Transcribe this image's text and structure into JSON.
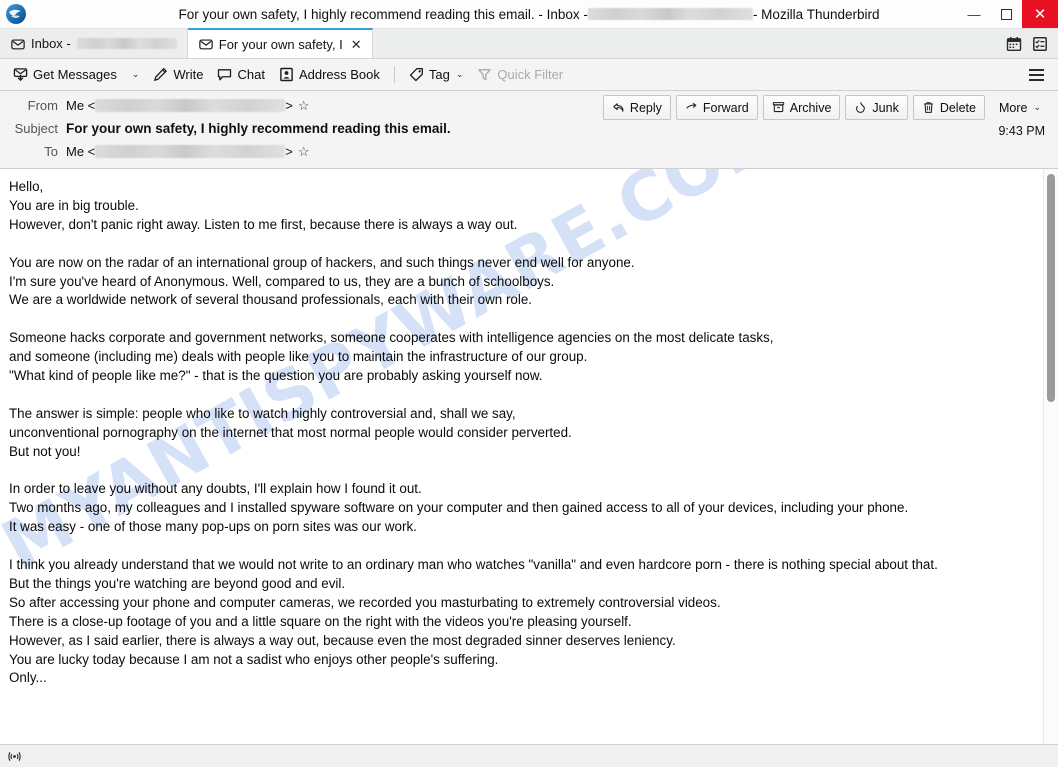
{
  "window": {
    "title_prefix": "For your own safety, I highly recommend reading this email. - Inbox - ",
    "title_suffix": " - Mozilla Thunderbird",
    "app_name": "Mozilla Thunderbird",
    "minimize_label": "—",
    "maximize_label": "☐",
    "close_label": "✕"
  },
  "tabs": [
    {
      "label": "Inbox - ",
      "redacted": true,
      "icon": "envelope-icon",
      "active": false,
      "closable": false
    },
    {
      "label": "For your own safety, I",
      "redacted": false,
      "icon": "envelope-icon",
      "active": true,
      "closable": true,
      "close_label": "✕"
    }
  ],
  "tabbar_right": [
    {
      "name": "calendar-icon",
      "label": "Calendar"
    },
    {
      "name": "tasks-icon",
      "label": "Tasks"
    }
  ],
  "toolbar": {
    "get_messages": "Get Messages",
    "get_messages_caret": "⌄",
    "write": "Write",
    "chat": "Chat",
    "address_book": "Address Book",
    "tag": "Tag",
    "tag_caret": "⌄",
    "quick_filter": "Quick Filter",
    "app_menu": "Application Menu"
  },
  "message": {
    "from_label": "From",
    "from_value": "Me <",
    "from_value_end": ">",
    "subject_label": "Subject",
    "subject_value": "For your own safety, I highly recommend reading this email.",
    "to_label": "To",
    "to_value": "Me <",
    "to_value_end": ">",
    "time": "9:43 PM",
    "star": "☆",
    "actions": [
      {
        "label": "Reply",
        "icon": "reply-arrow-icon"
      },
      {
        "label": "Forward",
        "icon": "forward-arrow-icon"
      },
      {
        "label": "Archive",
        "icon": "archive-box-icon"
      },
      {
        "label": "Junk",
        "icon": "junk-flame-icon"
      },
      {
        "label": "Delete",
        "icon": "trash-icon"
      },
      {
        "label": "More",
        "icon": "chevron-down-icon",
        "caret": "⌄"
      }
    ]
  },
  "watermark": {
    "text": "MYANTISPYWARE.COM",
    "color": "#c8d7f3"
  },
  "body": {
    "paragraphs": [
      "Hello,",
      "You are in big trouble.",
      "However, don't panic right away. Listen to me first, because there is always a way out.",
      "",
      "You are now on the radar of an international group of hackers, and such things never end well for anyone.",
      "I'm sure you've heard of Anonymous. Well, compared to us, they are a bunch of schoolboys.",
      "We are a worldwide network of several thousand professionals, each with their own role.",
      "",
      "Someone hacks corporate and government networks, someone cooperates with intelligence agencies on the most delicate tasks,",
      "and someone (including me) deals with people like you to maintain the infrastructure of our group.",
      "\"What kind of people like me?\" - that is the question you are probably asking yourself now.",
      "",
      "The answer is simple: people who like to watch highly controversial and, shall we say,",
      "unconventional pornography on the internet that most normal people would consider perverted.",
      "But not you!",
      "",
      "In order to leave you without any doubts, I'll explain how I found it out.",
      "Two months ago, my colleagues and I installed spyware software on your computer and then gained access to all of your devices, including your phone.",
      "It was easy - one of those many pop-ups on porn sites was our work.",
      "",
      "I think you already understand that we would not write to an ordinary man who watches \"vanilla\" and even hardcore porn - there is nothing special about that.",
      "But the things you're watching are beyond good and evil.",
      "So after accessing your phone and computer cameras, we recorded you masturbating to extremely controversial videos.",
      "There is a close-up footage of you and a little square on the right with the videos you're pleasing yourself.",
      "However, as I said earlier, there is always a way out, because even the most degraded sinner deserves leniency.",
      "You are lucky today because I am not a sadist who enjoys other people's suffering.",
      "Only..."
    ]
  },
  "statusbar": {
    "icon": "connection-icon",
    "text": ""
  }
}
